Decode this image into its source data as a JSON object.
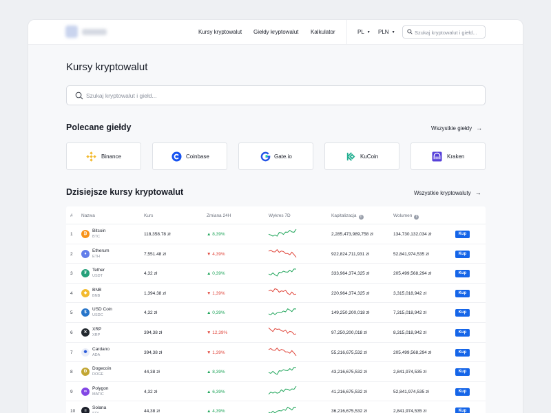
{
  "nav": {
    "links": [
      "Kursy kryptowalut",
      "Giełdy kryptowalut",
      "Kalkulator"
    ],
    "language": "PL",
    "currency": "PLN",
    "search_placeholder": "Szukaj kryptowalut i giełd..."
  },
  "page": {
    "title": "Kursy kryptowalut",
    "search_placeholder": "Szukaj kryptowalut i giełd..."
  },
  "exchanges": {
    "title": "Polecane giełdy",
    "see_all": "Wszystkie giełdy",
    "items": [
      {
        "name": "Binance",
        "icon": "binance-icon",
        "color": "#f3ba2f"
      },
      {
        "name": "Coinbase",
        "icon": "coinbase-icon",
        "color": "#1652f0"
      },
      {
        "name": "Gate.io",
        "icon": "gateio-icon",
        "color": "#2354e6"
      },
      {
        "name": "KuCoin",
        "icon": "kucoin-icon",
        "color": "#23af91"
      },
      {
        "name": "Kraken",
        "icon": "kraken-icon",
        "color": "#5741d9"
      }
    ]
  },
  "rates": {
    "title": "Dzisiejsze kursy kryptowalut",
    "see_all": "Wszystkie kryptowaluty",
    "columns": {
      "num": "#",
      "name": "Nazwa",
      "price": "Kurs",
      "change": "Zmiana 24H",
      "chart": "Wykres 7D",
      "cap": "Kapitalizacja",
      "volume": "Wolumen"
    },
    "buy_label": "Kup",
    "rows": [
      {
        "num": "1",
        "name": "Bitcoin",
        "symbol": "BTC",
        "price": "118,358.78 zł",
        "change": "8,39%",
        "dir": "up",
        "cap": "2,285,473,989,758 zł",
        "volume": "134,730,132,034 zł",
        "icon": "bitcoin-icon",
        "color": "#f7931a",
        "glyph": "₿"
      },
      {
        "num": "2",
        "name": "Etherum",
        "symbol": "ETH",
        "price": "7,551.48 zł",
        "change": "4,39%",
        "dir": "down",
        "cap": "922,824,711,931 zł",
        "volume": "52,841,974,535 zł",
        "icon": "ethereum-icon",
        "color": "#627eea",
        "glyph": "♦"
      },
      {
        "num": "3",
        "name": "Tether",
        "symbol": "USDT",
        "price": "4,32 zł",
        "change": "0,39%",
        "dir": "up",
        "cap": "333,964,374,325 zł",
        "volume": "205,499,568,294 zł",
        "icon": "tether-icon",
        "color": "#26a17b",
        "glyph": "₮"
      },
      {
        "num": "4",
        "name": "BNB",
        "symbol": "BNB",
        "price": "1,394.38 zł",
        "change": "1,39%",
        "dir": "down",
        "cap": "220,964,374,325 zł",
        "volume": "3,315,018,942 zł",
        "icon": "bnb-icon",
        "color": "#f3ba2f",
        "glyph": "◆"
      },
      {
        "num": "5",
        "name": "USD Coin",
        "symbol": "USDC",
        "price": "4,32 zł",
        "change": "0,39%",
        "dir": "up",
        "cap": "149,250,200,018 zł",
        "volume": "7,315,018,942 zł",
        "icon": "usd-coin-icon",
        "color": "#2775ca",
        "glyph": "$"
      },
      {
        "num": "6",
        "name": "XRP",
        "symbol": "XRP",
        "price": "394,38 zł",
        "change": "12,39%",
        "dir": "down",
        "cap": "97,250,200,018 zł",
        "volume": "8,315,018,942 zł",
        "icon": "xrp-icon",
        "color": "#23292f",
        "glyph": "✕"
      },
      {
        "num": "7",
        "name": "Cardano",
        "symbol": "ADA",
        "price": "394,38 zł",
        "change": "1,39%",
        "dir": "down",
        "cap": "55,216,675,532 zł",
        "volume": "205,499,568,294 zł",
        "icon": "cardano-icon",
        "color": "#e9edf8",
        "glyph": "✺"
      },
      {
        "num": "8",
        "name": "Dogecoin",
        "symbol": "DOGE",
        "price": "44,38 zł",
        "change": "8,39%",
        "dir": "up",
        "cap": "43,216,675,532 zł",
        "volume": "2,841,974,535 zł",
        "icon": "dogecoin-icon",
        "color": "#c2a633",
        "glyph": "Ð"
      },
      {
        "num": "9",
        "name": "Polygon",
        "symbol": "MATIC",
        "price": "4,32 zł",
        "change": "6,39%",
        "dir": "up",
        "cap": "41,216,675,532 zł",
        "volume": "52,841,974,535 zł",
        "icon": "polygon-icon",
        "color": "#8247e5",
        "glyph": "∞"
      },
      {
        "num": "10",
        "name": "Solana",
        "symbol": "SOL",
        "price": "44,38 zł",
        "change": "4,39%",
        "dir": "up",
        "cap": "36,216,675,532 zł",
        "volume": "2,841,974,535 zł",
        "icon": "solana-icon",
        "color": "#1b1f2a",
        "glyph": "≡"
      }
    ]
  },
  "colors": {
    "up": "#1fa55a",
    "down": "#e0453a",
    "accent": "#1565e8"
  }
}
